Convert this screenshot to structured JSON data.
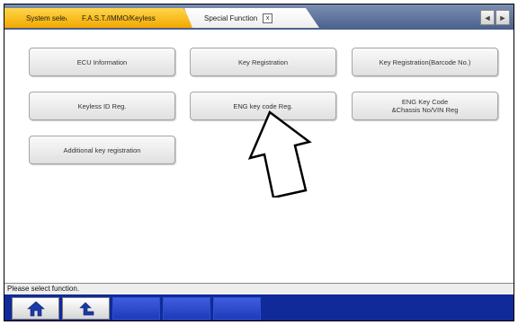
{
  "tabs": [
    {
      "label": "System select",
      "active": false
    },
    {
      "label": "F.A.S.T./IMMO/Keyless",
      "active": false
    },
    {
      "label": "Special Function",
      "active": true,
      "close_label": "x"
    }
  ],
  "scroll": {
    "left": "◄",
    "right": "►"
  },
  "functions": [
    {
      "label": "ECU Information"
    },
    {
      "label": "Key Registration"
    },
    {
      "label": "Key Registration(Barcode No.)"
    },
    {
      "label": "Keyless ID Reg."
    },
    {
      "label": "ENG key code Reg."
    },
    {
      "label": "ENG Key Code\n&Chassis No/VIN Reg"
    },
    {
      "label": "Additional key registration"
    }
  ],
  "status_text": "Please select function.",
  "toolbar": {
    "buttons": [
      {
        "icon": "home-icon"
      },
      {
        "icon": "back-arrow-icon"
      },
      {
        "icon": ""
      },
      {
        "icon": ""
      },
      {
        "icon": ""
      }
    ]
  },
  "colors": {
    "tab_yellow": "#f2a800",
    "toolbar_blue": "#102a9a",
    "tabbar_blue": "#4a5f8a"
  }
}
